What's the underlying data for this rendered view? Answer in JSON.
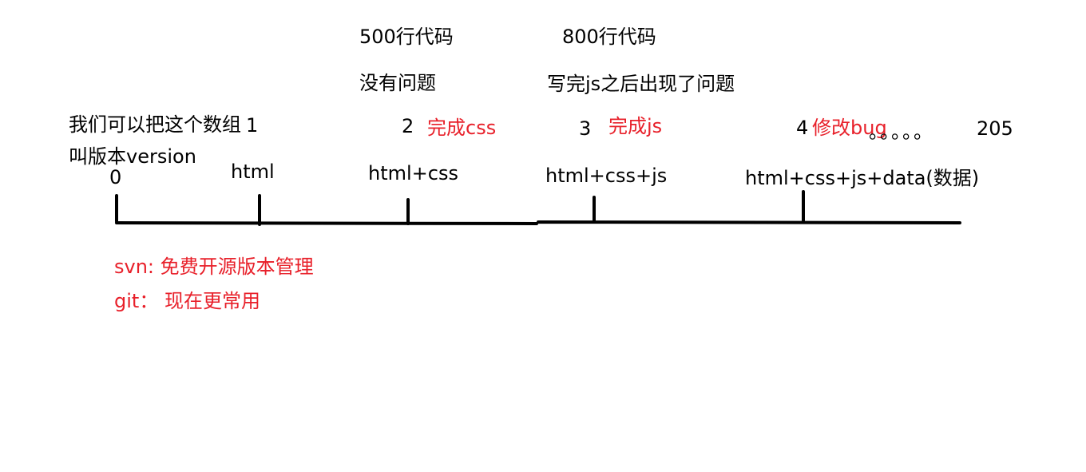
{
  "notes": {
    "lines_500": "500行代码",
    "no_problem": "没有问题",
    "lines_800": "800行代码",
    "js_problem": "写完js之后出现了问题",
    "array_note_1": "我们可以把这个数组",
    "array_note_2": "叫版本version",
    "svn": "svn: 免费开源版本管理",
    "git": "git： 现在更常用"
  },
  "versions": [
    {
      "number": "0",
      "content": ""
    },
    {
      "number": "1",
      "content": "html"
    },
    {
      "number": "2",
      "content": "html+css",
      "annotation": "完成css"
    },
    {
      "number": "3",
      "content": "html+css+js",
      "annotation": "完成js"
    },
    {
      "number": "4",
      "content": "html+css+js+data(数据)",
      "annotation": "修改bug"
    }
  ],
  "ellipsis": "。。。。。",
  "last_version": "205",
  "colors": {
    "text": "#000000",
    "annotation": "#e8202a",
    "line": "#000000"
  }
}
